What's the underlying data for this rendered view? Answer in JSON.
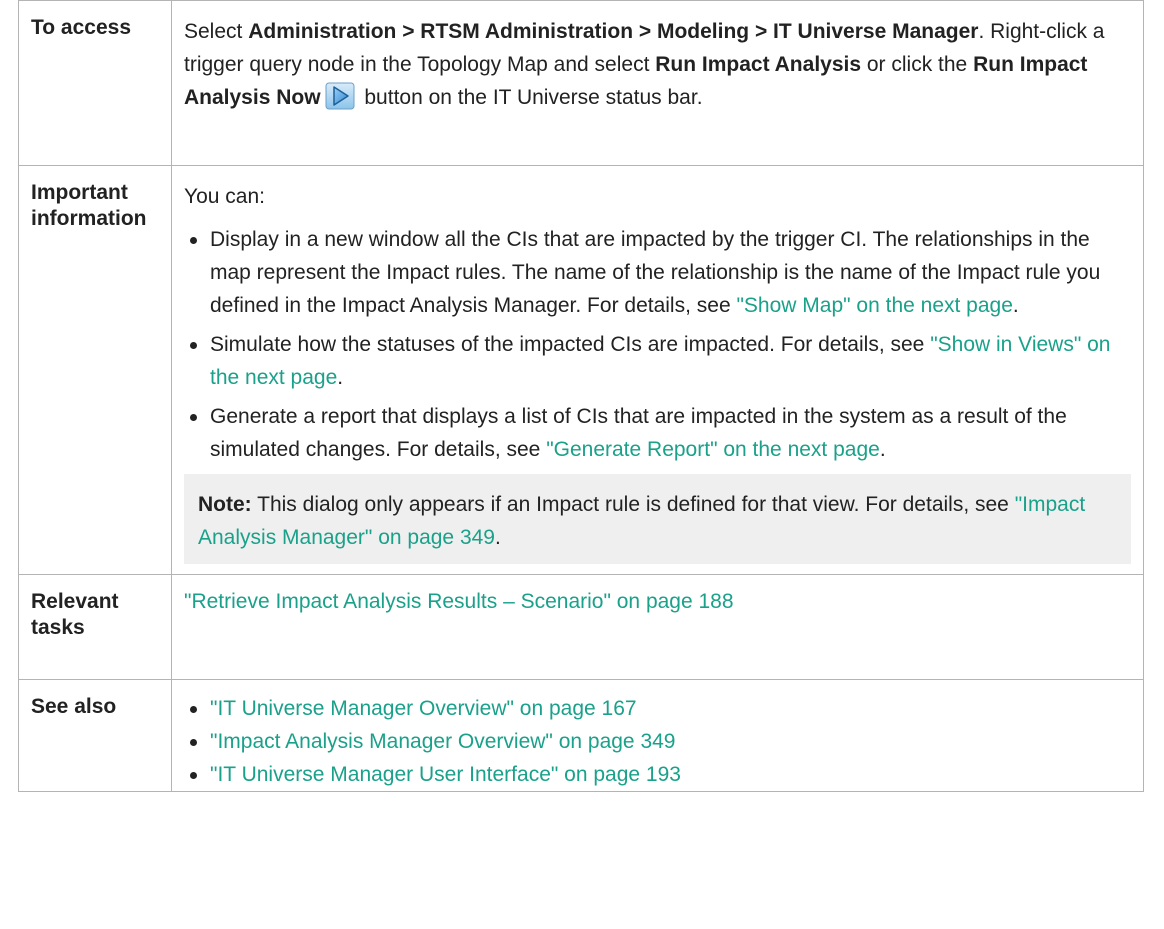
{
  "rows": {
    "access": {
      "label": "To access",
      "t1": "Select ",
      "path": "Administration > RTSM Administration > Modeling > IT Universe Manager",
      "t2": ". Right-click a trigger query node in the Topology Map and select ",
      "run": "Run Impact Analysis",
      "t3": " or click the ",
      "run_now": "Run Impact Analysis Now",
      "t4": " button on the IT Universe status bar.",
      "icon": "run-impact-analysis-now-icon"
    },
    "info": {
      "label": "Important information",
      "intro": "You can:",
      "bullets": [
        {
          "text": "Display in a new window all the CIs that are impacted by the trigger CI. The relationships in the map represent the Impact rules. The name of the relationship is the name of the Impact rule you defined in the Impact Analysis Manager. For details, see ",
          "link": "\"Show Map\" on the next page",
          "end": "."
        },
        {
          "text": "Simulate how the statuses of the impacted CIs are impacted. For details, see ",
          "link": "\"Show in Views\" on the next page",
          "end": "."
        },
        {
          "text": "Generate a report that displays a list of CIs that are impacted in the system as a result of the simulated changes. For details, see ",
          "link": "\"Generate Report\" on the next page",
          "end": "."
        }
      ],
      "note": {
        "label": "Note:",
        "text": " This dialog only appears if an Impact rule is defined for that view. For details, see ",
        "link": "\"Impact Analysis Manager\" on page 349",
        "end": "."
      }
    },
    "tasks": {
      "label": "Relevant tasks",
      "link": "\"Retrieve Impact Analysis Results – Scenario\" on page 188"
    },
    "see_also": {
      "label": "See also",
      "links": [
        "\"IT Universe Manager Overview\" on page 167",
        "\"Impact Analysis Manager Overview\" on page 349",
        "\"IT Universe Manager User Interface\" on page 193"
      ]
    }
  },
  "colors": {
    "link": "#1aa18a",
    "border": "#b4b4b4",
    "note_bg": "#efefef",
    "text": "#222222"
  }
}
